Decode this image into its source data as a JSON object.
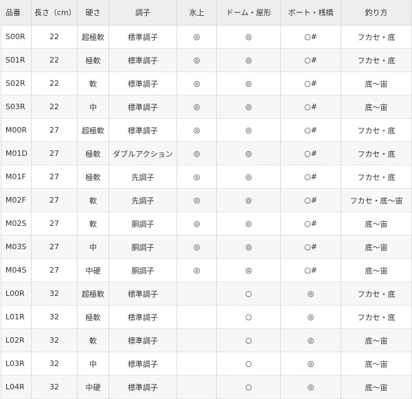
{
  "headers": [
    "品番",
    "長さ（cm）",
    "硬さ",
    "調子",
    "氷上",
    "ドーム・屋形",
    "ボート・桟橋",
    "釣り方"
  ],
  "rows": [
    [
      "S00R",
      "22",
      "超極軟",
      "標準調子",
      "◎",
      "◎",
      "○#",
      "フカセ・底"
    ],
    [
      "S01R",
      "22",
      "極軟",
      "標準調子",
      "◎",
      "◎",
      "○#",
      "フカセ・底"
    ],
    [
      "S02R",
      "22",
      "軟",
      "標準調子",
      "◎",
      "◎",
      "○#",
      "底～宙"
    ],
    [
      "S03R",
      "22",
      "中",
      "標準調子",
      "◎",
      "◎",
      "○#",
      "底～宙"
    ],
    [
      "M00R",
      "27",
      "超極軟",
      "標準調子",
      "◎",
      "◎",
      "○#",
      "フカセ・底"
    ],
    [
      "M01D",
      "27",
      "極軟",
      "ダブルアクション",
      "◎",
      "◎",
      "○#",
      "フカセ・底"
    ],
    [
      "M01F",
      "27",
      "極軟",
      "先調子",
      "◎",
      "◎",
      "○#",
      "フカセ・底"
    ],
    [
      "M02F",
      "27",
      "軟",
      "先調子",
      "◎",
      "◎",
      "○#",
      "フカセ・底～宙"
    ],
    [
      "M02S",
      "27",
      "軟",
      "胴調子",
      "◎",
      "◎",
      "○#",
      "底～宙"
    ],
    [
      "M03S",
      "27",
      "中",
      "胴調子",
      "◎",
      "◎",
      "○#",
      "底～宙"
    ],
    [
      "M04S",
      "27",
      "中硬",
      "胴調子",
      "◎",
      "◎",
      "○#",
      "底～宙"
    ],
    [
      "L00R",
      "32",
      "超極軟",
      "標準調子",
      "",
      "○",
      "◎",
      "フカセ・底"
    ],
    [
      "L01R",
      "32",
      "極軟",
      "標準調子",
      "",
      "○",
      "◎",
      "フカセ・底"
    ],
    [
      "L02R",
      "32",
      "軟",
      "標準調子",
      "",
      "○",
      "◎",
      "底～宙"
    ],
    [
      "L03R",
      "32",
      "中",
      "標準調子",
      "",
      "○",
      "◎",
      "底～宙"
    ],
    [
      "L04R",
      "32",
      "中硬",
      "標準調子",
      "",
      "○",
      "◎",
      "底～宙"
    ]
  ]
}
